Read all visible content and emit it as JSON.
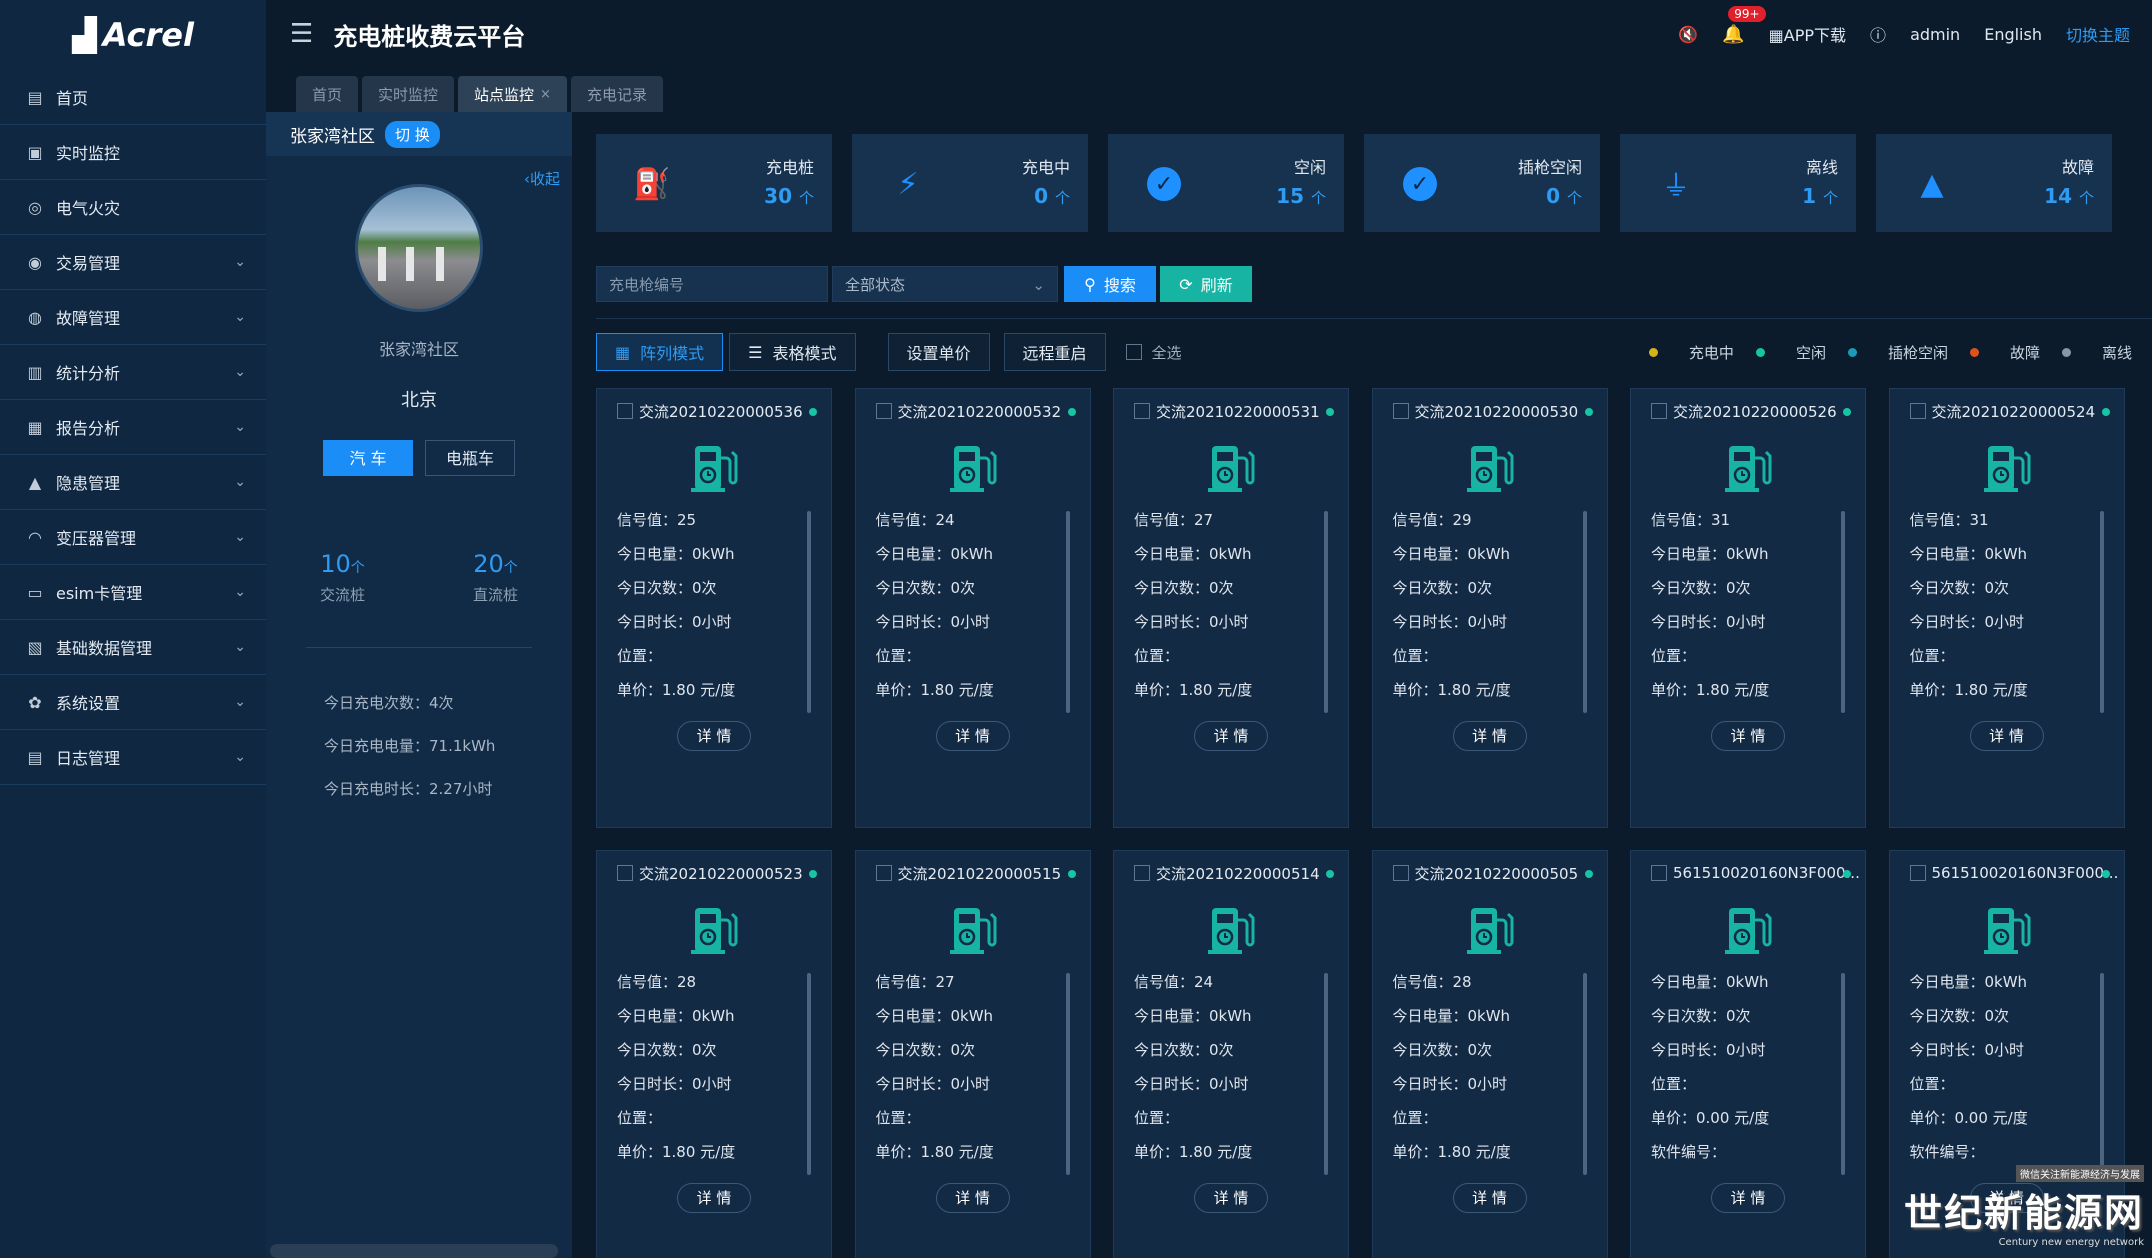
{
  "brand": {
    "logo": "Acrel",
    "app_title": "充电桩收费云平台"
  },
  "colors": {
    "accent": "#1a8df7",
    "teal": "#17b3a3",
    "charging": "#d4b21a",
    "idle": "#17c5a5",
    "plugged_idle": "#1b9bb8",
    "fault": "#e0521a",
    "offline": "#8a96a3"
  },
  "sidebar": {
    "items": [
      {
        "label": "首页",
        "icon": "home-icon",
        "expandable": false
      },
      {
        "label": "实时监控",
        "icon": "monitor-icon",
        "expandable": false
      },
      {
        "label": "电气火灾",
        "icon": "fire-icon",
        "expandable": false
      },
      {
        "label": "交易管理",
        "icon": "money-icon",
        "expandable": true
      },
      {
        "label": "故障管理",
        "icon": "fault-icon",
        "expandable": true
      },
      {
        "label": "统计分析",
        "icon": "bar-chart-icon",
        "expandable": true
      },
      {
        "label": "报告分析",
        "icon": "report-icon",
        "expandable": true
      },
      {
        "label": "隐患管理",
        "icon": "warning-icon",
        "expandable": true
      },
      {
        "label": "变压器管理",
        "icon": "transformer-icon",
        "expandable": true
      },
      {
        "label": "esim卡管理",
        "icon": "sim-card-icon",
        "expandable": true
      },
      {
        "label": "基础数据管理",
        "icon": "database-icon",
        "expandable": true
      },
      {
        "label": "系统设置",
        "icon": "gear-icon",
        "expandable": true
      },
      {
        "label": "日志管理",
        "icon": "log-icon",
        "expandable": true
      }
    ]
  },
  "header": {
    "notification_count": "99+",
    "app_download": "APP下载",
    "user": "admin",
    "language": "English",
    "switch_theme": "切换主题"
  },
  "tabs": [
    {
      "label": "首页",
      "active": false,
      "closable": false
    },
    {
      "label": "实时监控",
      "active": false,
      "closable": false
    },
    {
      "label": "站点监控",
      "active": true,
      "closable": true
    },
    {
      "label": "充电记录",
      "active": false,
      "closable": false
    }
  ],
  "station": {
    "name_header": "张家湾社区",
    "switch_label": "切 换",
    "collapse_label": "收起",
    "name": "张家湾社区",
    "city": "北京",
    "vehicle_types": [
      "汽 车",
      "电瓶车"
    ],
    "active_vehicle": 0,
    "ac_count": "10",
    "dc_count": "20",
    "unit": "个",
    "ac_label": "交流桩",
    "dc_label": "直流桩",
    "stats": [
      "今日充电次数：4次",
      "今日充电电量：71.1kWh",
      "今日充电时长：2.27小时"
    ]
  },
  "summary": [
    {
      "label": "充电桩",
      "value": "30",
      "unit": "个",
      "icon": "charger-icon"
    },
    {
      "label": "充电中",
      "value": "0",
      "unit": "个",
      "icon": "lightning-icon"
    },
    {
      "label": "空闲",
      "value": "15",
      "unit": "个",
      "icon": "check-circle-icon"
    },
    {
      "label": "插枪空闲",
      "value": "0",
      "unit": "个",
      "icon": "check-circle-icon"
    },
    {
      "label": "离线",
      "value": "1",
      "unit": "个",
      "icon": "plug-icon"
    },
    {
      "label": "故障",
      "value": "14",
      "unit": "个",
      "icon": "alert-triangle-icon"
    }
  ],
  "filters": {
    "gun_placeholder": "充电枪编号",
    "status_select": "全部状态",
    "search_label": "搜索",
    "refresh_label": "刷新"
  },
  "modes": {
    "grid_mode": "阵列模式",
    "table_mode": "表格模式",
    "set_price": "设置单价",
    "remote_restart": "远程重启",
    "select_all": "全选"
  },
  "legend": [
    {
      "label": "充电中",
      "color": "#d4b21a"
    },
    {
      "label": "空闲",
      "color": "#17c5a5"
    },
    {
      "label": "插枪空闲",
      "color": "#1b9bb8"
    },
    {
      "label": "故障",
      "color": "#e0521a"
    },
    {
      "label": "离线",
      "color": "#8a96a3"
    }
  ],
  "detail_label": "详 情",
  "piles": [
    {
      "id": "交流20210220000536",
      "lines": [
        "信号值：25",
        "今日电量：0kWh",
        "今日次数：0次",
        "今日时长：0小时",
        "位置：",
        "单价：1.80 元/度"
      ]
    },
    {
      "id": "交流20210220000532",
      "lines": [
        "信号值：24",
        "今日电量：0kWh",
        "今日次数：0次",
        "今日时长：0小时",
        "位置：",
        "单价：1.80 元/度"
      ]
    },
    {
      "id": "交流20210220000531",
      "lines": [
        "信号值：27",
        "今日电量：0kWh",
        "今日次数：0次",
        "今日时长：0小时",
        "位置：",
        "单价：1.80 元/度"
      ]
    },
    {
      "id": "交流20210220000530",
      "lines": [
        "信号值：29",
        "今日电量：0kWh",
        "今日次数：0次",
        "今日时长：0小时",
        "位置：",
        "单价：1.80 元/度"
      ]
    },
    {
      "id": "交流20210220000526",
      "lines": [
        "信号值：31",
        "今日电量：0kWh",
        "今日次数：0次",
        "今日时长：0小时",
        "位置：",
        "单价：1.80 元/度"
      ]
    },
    {
      "id": "交流20210220000524",
      "lines": [
        "信号值：31",
        "今日电量：0kWh",
        "今日次数：0次",
        "今日时长：0小时",
        "位置：",
        "单价：1.80 元/度"
      ]
    },
    {
      "id": "交流20210220000523",
      "lines": [
        "信号值：28",
        "今日电量：0kWh",
        "今日次数：0次",
        "今日时长：0小时",
        "位置：",
        "单价：1.80 元/度"
      ]
    },
    {
      "id": "交流20210220000515",
      "lines": [
        "信号值：27",
        "今日电量：0kWh",
        "今日次数：0次",
        "今日时长：0小时",
        "位置：",
        "单价：1.80 元/度"
      ]
    },
    {
      "id": "交流20210220000514",
      "lines": [
        "信号值：24",
        "今日电量：0kWh",
        "今日次数：0次",
        "今日时长：0小时",
        "位置：",
        "单价：1.80 元/度"
      ]
    },
    {
      "id": "交流20210220000505",
      "lines": [
        "信号值：28",
        "今日电量：0kWh",
        "今日次数：0次",
        "今日时长：0小时",
        "位置：",
        "单价：1.80 元/度"
      ]
    },
    {
      "id": "561510020160N3F000...",
      "lines": [
        "今日电量：0kWh",
        "今日次数：0次",
        "今日时长：0小时",
        "位置：",
        "单价：0.00 元/度",
        "软件编号："
      ]
    },
    {
      "id": "561510020160N3F000...",
      "lines": [
        "今日电量：0kWh",
        "今日次数：0次",
        "今日时长：0小时",
        "位置：",
        "单价：0.00 元/度",
        "软件编号："
      ]
    }
  ],
  "watermark": {
    "small": "微信关注新能源经济与发展",
    "big": "世纪新能源网",
    "en": "Century new energy network"
  }
}
